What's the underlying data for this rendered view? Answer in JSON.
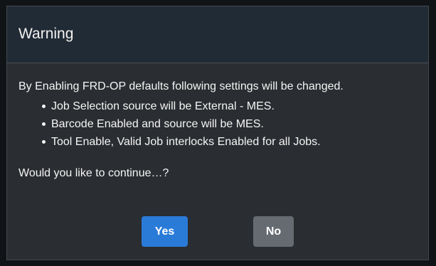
{
  "dialog": {
    "title": "Warning",
    "intro": "By Enabling FRD-OP defaults following settings will be changed.",
    "bullets": [
      "Job Selection source will be External - MES.",
      "Barcode Enabled and source will be MES.",
      "Tool Enable, Valid Job interlocks Enabled for all Jobs."
    ],
    "question": "Would you like to continue…?",
    "buttons": {
      "yes": "Yes",
      "no": "No"
    }
  },
  "colors": {
    "yes_button": "#2a7bd8",
    "no_button": "#666b72",
    "header_bg": "#212b35",
    "dialog_bg": "#2a2d31"
  }
}
